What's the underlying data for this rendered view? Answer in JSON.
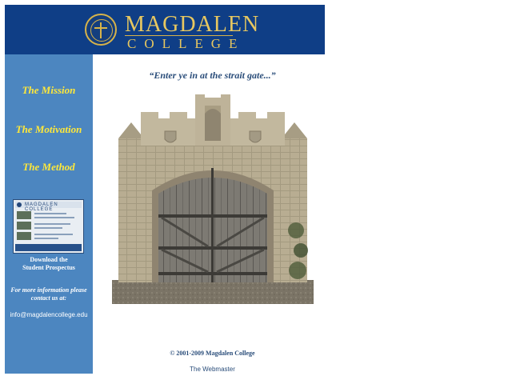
{
  "header": {
    "brand_line1": "MAGDALEN",
    "brand_line2": "COLLEGE",
    "seal_icon": "college-seal-icon",
    "background_color": "#0f3e86",
    "brand_color": "#e7c760"
  },
  "sidebar": {
    "background_color": "#4c86c0",
    "link_color": "#ffe83a",
    "links": [
      {
        "label": "The Mission"
      },
      {
        "label": "The Motivation"
      },
      {
        "label": "The Method"
      }
    ],
    "prospectus": {
      "thumb_title": "MAGDALEN COLLEGE",
      "label_line1": "Download the",
      "label_line2": "Student Prospectus"
    },
    "contact": {
      "line1": "For more information please",
      "line2": "contact us at:",
      "email": "info@magdalencollege.edu"
    }
  },
  "main": {
    "quote": "“Enter ye in at the strait gate...”",
    "image_icon": "stone-gate-image",
    "copyright": "© 2001-2009 Magdalen College",
    "webmaster": "The Webmaster"
  }
}
